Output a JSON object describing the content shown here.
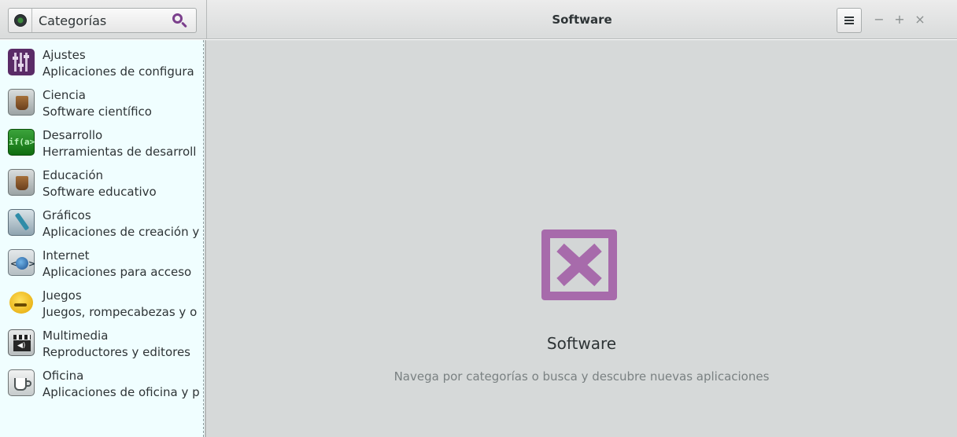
{
  "window": {
    "title": "Software",
    "controls": {
      "minimize": "−",
      "maximize": "+",
      "close": "×"
    },
    "menu_icon": "hamburger-menu-icon"
  },
  "header_left": {
    "category_button_label": "Categorías",
    "category_icon": "category-dot-icon",
    "search_icon": "search-icon",
    "accent_color": "#7b3f8c"
  },
  "sidebar": {
    "background": "#f0feff",
    "items": [
      {
        "name": "Ajustes",
        "description": "Aplicaciones de configura",
        "icon": "settings-icon"
      },
      {
        "name": "Ciencia",
        "description": "Software científico",
        "icon": "flask-icon"
      },
      {
        "name": "Desarrollo",
        "description": "Herramientas de desarroll",
        "icon": "developer-icon"
      },
      {
        "name": "Educación",
        "description": "Software educativo",
        "icon": "flask-icon"
      },
      {
        "name": "Gráficos",
        "description": "Aplicaciones de creación y",
        "icon": "graphics-icon"
      },
      {
        "name": "Internet",
        "description": "Aplicaciones para acceso",
        "icon": "internet-icon"
      },
      {
        "name": "Juegos",
        "description": "Juegos, rompecabezas y o",
        "icon": "games-icon"
      },
      {
        "name": "Multimedia",
        "description": "Reproductores y editores",
        "icon": "multimedia-icon"
      },
      {
        "name": "Oficina",
        "description": "Aplicaciones de oficina y p",
        "icon": "office-icon"
      }
    ]
  },
  "main": {
    "placeholder_icon": "image-missing-icon",
    "placeholder_color": "#a76bab",
    "title": "Software",
    "subtitle": "Navega por categorías o busca y descubre nuevas aplicaciones"
  }
}
